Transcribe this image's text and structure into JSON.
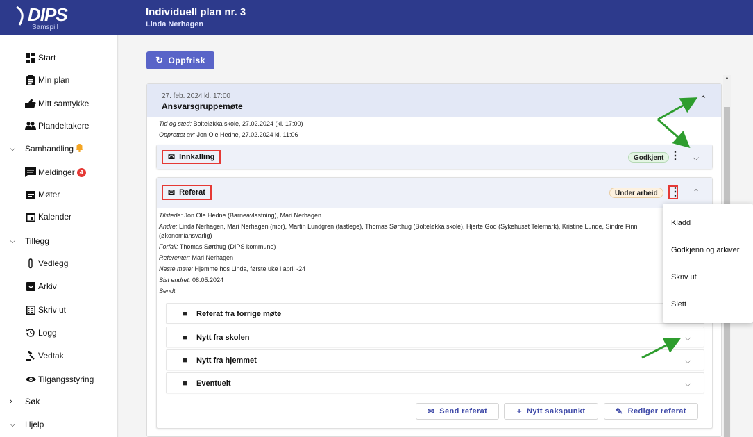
{
  "app": {
    "logo_text": "DIPS",
    "logo_sub": "Samspill",
    "title": "Individuell plan nr. 3",
    "subtitle": "Linda Nerhagen"
  },
  "sidebar": {
    "items": [
      {
        "label": "Start",
        "icon": "dashboard-icon"
      },
      {
        "label": "Min plan",
        "icon": "clipboard-icon"
      },
      {
        "label": "Mitt samtykke",
        "icon": "thumbs-up-icon"
      },
      {
        "label": "Plandeltakere",
        "icon": "people-icon"
      },
      {
        "label": "Samhandling",
        "icon": "chevron-down-icon",
        "group": true,
        "notification": "bell-icon"
      },
      {
        "label": "Meldinger",
        "icon": "message-icon",
        "badge": "4"
      },
      {
        "label": "Møter",
        "icon": "calendar-list-icon"
      },
      {
        "label": "Kalender",
        "icon": "calendar-icon"
      },
      {
        "label": "Tillegg",
        "icon": "chevron-down-icon",
        "group": true
      },
      {
        "label": "Vedlegg",
        "icon": "paperclip-icon"
      },
      {
        "label": "Arkiv",
        "icon": "archive-icon"
      },
      {
        "label": "Skriv ut",
        "icon": "list-icon"
      },
      {
        "label": "Logg",
        "icon": "history-icon"
      },
      {
        "label": "Vedtak",
        "icon": "gavel-icon"
      },
      {
        "label": "Tilgangsstyring",
        "icon": "eye-icon"
      },
      {
        "label": "Søk",
        "icon": "chevron-right-icon",
        "group": true
      },
      {
        "label": "Hjelp",
        "icon": "chevron-down-icon",
        "group": true
      }
    ]
  },
  "toolbar": {
    "refresh_label": "Oppfrisk"
  },
  "meeting": {
    "date": "27. feb. 2024 kl. 17:00",
    "title": "Ansvarsgruppemøte",
    "place_label": "Tid og sted:",
    "place_value": " Bolteløkka skole, 27.02.2024 (kl. 17:00)",
    "created_label": "Opprettet av:",
    "created_value": " Jon Ole Hedne, 27.02.2024 kl. 11:06"
  },
  "innkalling": {
    "label": "Innkalling",
    "status": "Godkjent"
  },
  "referat": {
    "label": "Referat",
    "status": "Under arbeid",
    "present_label": "Tilstede:",
    "present_value": " Jon Ole Hedne (Barneavlastning), Mari Nerhagen",
    "others_label": "Andre:",
    "others_value": " Linda Nerhagen, Mari Nerhagen (mor), Martin Lundgren (fastlege), Thomas Sørthug (Bolteløkka skole), Hjerte God (Sykehuset Telemark), Kristine Lunde, Sindre Finn",
    "others_cont": "(økonomiansvarlig)",
    "due_label": "Forfall:",
    "due_value": " Thomas Sørthug (DIPS kommune)",
    "ref_label": "Referenter:",
    "ref_value": " Mari Nerhagen",
    "next_label": "Neste møte:",
    "next_value": " Hjemme hos Linda, første uke i april -24",
    "changed_label": "Sist endret:",
    "changed_value": " 08.05.2024",
    "sent_label": "Sendt:",
    "sections": [
      {
        "label": "Referat fra forrige møte"
      },
      {
        "label": "Nytt fra skolen"
      },
      {
        "label": "Nytt fra hjemmet"
      },
      {
        "label": "Eventuelt"
      }
    ],
    "actions": {
      "send": "Send referat",
      "new_item": "Nytt sakspunkt",
      "edit": "Rediger referat"
    }
  },
  "context_menu": {
    "items": [
      {
        "label": "Kladd"
      },
      {
        "label": "Godkjenn og arkiver"
      },
      {
        "label": "Skriv ut"
      },
      {
        "label": "Slett"
      }
    ]
  },
  "colors": {
    "header": "#2d3a8c",
    "accent": "#5964c8",
    "highlight": "#e53935",
    "annotation_arrow": "#2e9d2e"
  }
}
